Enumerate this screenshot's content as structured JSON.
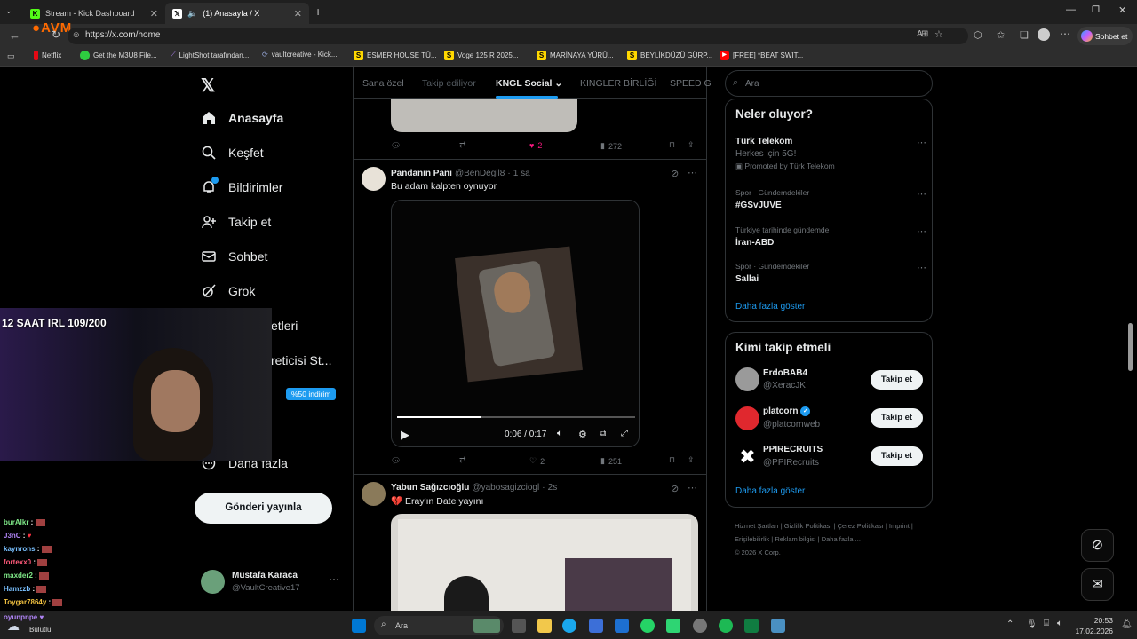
{
  "browser": {
    "tabs": [
      {
        "title": "Stream - Kick Dashboard",
        "icon": "kick-icon"
      },
      {
        "title": "(1) Anasayfa / X",
        "icon": "x-logo-icon"
      }
    ],
    "url": "https://x.com/home",
    "overlay_logo": "AVM",
    "copilot_label": "Sohbet et",
    "bookmarks": [
      "Netflix",
      "Get the M3U8 File...",
      "LightShot tarafından...",
      "vaultcreative - Kick...",
      "ESMER HOUSE TÜ...",
      "Voge 125 R 2025...",
      "MARİNAYA YÜRÜ...",
      "BEYLİKDÜZÜ GÜRP...",
      "[FREE] *BEAT SWIT..."
    ]
  },
  "x": {
    "nav": [
      {
        "label": "Anasayfa",
        "icon": "home-icon"
      },
      {
        "label": "Keşfet",
        "icon": "search-icon"
      },
      {
        "label": "Bildirimler",
        "icon": "bell-icon"
      },
      {
        "label": "Takip et",
        "icon": "follow-icon"
      },
      {
        "label": "Sohbet",
        "icon": "mail-icon"
      },
      {
        "label": "Grok",
        "icon": "grok-icon"
      }
    ],
    "nav_partial": [
      "etleri",
      "reticisi St..."
    ],
    "discount_badge": "%50 indirim",
    "more_label": "Daha fazla",
    "post_button": "Gönderi yayınla",
    "user": {
      "name": "Mustafa Karaca",
      "handle": "@VaultCreative17"
    },
    "feed_tabs": [
      "Sana özel",
      "Takip ediliyor",
      "KNGL Social",
      "KINGLER BİRLİĞİ",
      "SPEED G"
    ],
    "post0": {
      "likes": "2",
      "views": "272"
    },
    "post1": {
      "name": "Pandanın Panı",
      "handle": "@BenDegil8",
      "time": "1 sa",
      "text": "Bu adam kalpten oynuyor",
      "video_time": "0:06 / 0:17",
      "likes": "2",
      "views": "251"
    },
    "post2": {
      "name": "Yabun Sağızcıoğlu",
      "handle": "@yabosagizciogl",
      "time": "2s",
      "text": "💔 Eray'ın Date yayını"
    },
    "search_placeholder": "Ara",
    "trends": {
      "title": "Neler oluyor?",
      "items": [
        {
          "ctx": "",
          "name": "Türk Telekom",
          "sub": "Herkes için 5G!",
          "promo": "Promoted by Türk Telekom"
        },
        {
          "ctx": "Spor · Gündemdekiler",
          "name": "#GSvJUVE",
          "sub": "",
          "promo": ""
        },
        {
          "ctx": "Türkiye tarihinde gündemde",
          "name": "İran-ABD",
          "sub": "",
          "promo": ""
        },
        {
          "ctx": "Spor · Gündemdekiler",
          "name": "Sallai",
          "sub": "",
          "promo": ""
        }
      ],
      "more": "Daha fazla göster"
    },
    "who": {
      "title": "Kimi takip etmeli",
      "follow_label": "Takip et",
      "more": "Daha fazla göster",
      "items": [
        {
          "name": "ErdoBAB4",
          "handle": "@XeracJK"
        },
        {
          "name": "platcorn",
          "handle": "@platcornweb"
        },
        {
          "name": "PPIRECRUITS",
          "handle": "@PPIRecruits"
        }
      ]
    },
    "footer": [
      "Hizmet Şartları",
      "|",
      "Gizlilik Politikası",
      "|",
      "Çerez Politikası",
      "|",
      "Imprint",
      "|",
      "Erişilebilirlik",
      "|",
      "Reklam bilgisi",
      "|",
      "Daha fazla ...",
      "© 2026 X Corp."
    ]
  },
  "stream": {
    "title": "12 SAAT IRL 109/200",
    "chat": [
      {
        "user": "burAlkr",
        "color": "#7ee787"
      },
      {
        "user": "J3nC",
        "color": "#b084f5"
      },
      {
        "user": "kaynrons",
        "color": "#79c0ff"
      },
      {
        "user": "fortexx0",
        "color": "#ff5a7a"
      },
      {
        "user": "maxder2",
        "color": "#7ee787"
      },
      {
        "user": "Hamzzb",
        "color": "#79c0ff"
      },
      {
        "user": "Toygar7864y",
        "color": "#f0c040"
      },
      {
        "user": "oyunpnpe",
        "color": "#b084f5"
      }
    ]
  },
  "taskbar": {
    "weather": "Bulutlu",
    "search": "Ara",
    "time": "20:53",
    "date": "17.02.2026"
  }
}
